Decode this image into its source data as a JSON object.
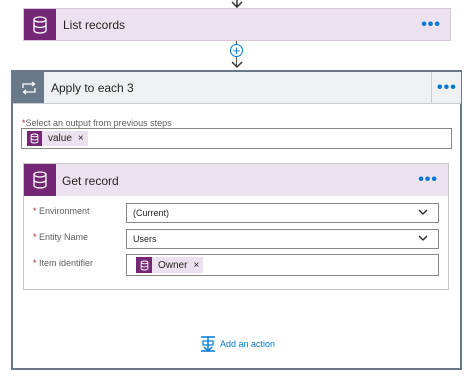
{
  "list_records": {
    "title": "List records",
    "menu": "•••"
  },
  "connector": {
    "plus": "+"
  },
  "apply_to_each": {
    "title": "Apply to each 3",
    "menu": "•••",
    "select_output_label": "Select an output from previous steps",
    "required_mark": "*",
    "token": {
      "label": "value",
      "remove": "×"
    }
  },
  "get_record": {
    "title": "Get record",
    "menu": "•••",
    "fields": [
      {
        "label": "Environment",
        "value": "(Current)"
      },
      {
        "label": "Entity Name",
        "value": "Users"
      },
      {
        "label": "Item identifier",
        "token": "Owner",
        "remove": "×"
      }
    ]
  },
  "add_action": {
    "label": "Add an action"
  },
  "colors": {
    "cds_purple": "#742774",
    "cds_card_bg": "#ece1ee",
    "loop_gray": "#69798a",
    "link_blue": "#0078d4",
    "required_red": "#a4262c"
  },
  "icons": {
    "cds": "database-icon",
    "loop": "loop-icon",
    "add": "add-action-icon",
    "chevron": "chevron-down-icon"
  }
}
